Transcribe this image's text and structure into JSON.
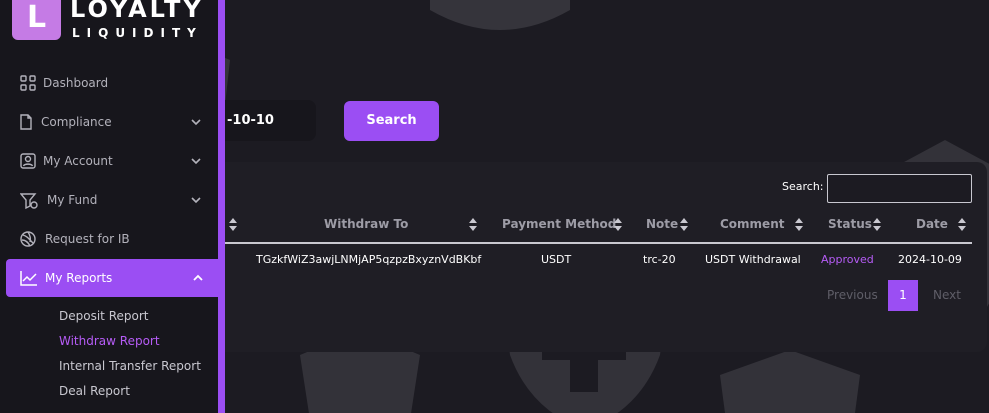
{
  "app": {
    "logo_letter": "L",
    "logo_title": "LOYALTY",
    "logo_subtitle": "LIQUIDITY"
  },
  "sidebar": {
    "items": [
      {
        "label": "Dashboard",
        "icon": "grid-icon",
        "expandable": false
      },
      {
        "label": "Compliance",
        "icon": "document-icon",
        "expandable": true
      },
      {
        "label": "My Account",
        "icon": "user-icon",
        "expandable": true
      },
      {
        "label": "My Fund",
        "icon": "funnel-dollar-icon",
        "expandable": true
      },
      {
        "label": "Request for IB",
        "icon": "globe-icon",
        "expandable": false
      },
      {
        "label": "My Reports",
        "icon": "chart-line-icon",
        "expandable": true,
        "active": true
      }
    ],
    "sub_items": [
      {
        "label": "Deposit Report"
      },
      {
        "label": "Withdraw Report",
        "active": true
      },
      {
        "label": "Internal Transfer Report"
      },
      {
        "label": "Deal Report"
      }
    ]
  },
  "filters": {
    "date_value": "-10-10",
    "search_button": "Search"
  },
  "table": {
    "search_label": "Search:",
    "search_value": "",
    "columns": [
      "Withdraw To",
      "Payment Method",
      "Note",
      "Comment",
      "Status",
      "Date"
    ],
    "rows": [
      {
        "withdraw_to": "TGzkfWiZ3awjLNMjAP5qzpzBxyznVdBKbf",
        "payment_method": "USDT",
        "note": "trc-20",
        "comment": "USDT Withdrawal",
        "status": "Approved",
        "date": "2024-10-09"
      }
    ]
  },
  "pagination": {
    "previous": "Previous",
    "current": "1",
    "next": "Next"
  },
  "colors": {
    "accent": "#9b4ef3",
    "status_approved": "#b65cf6",
    "background": "#1c1b22",
    "sidebar": "#17161c"
  }
}
